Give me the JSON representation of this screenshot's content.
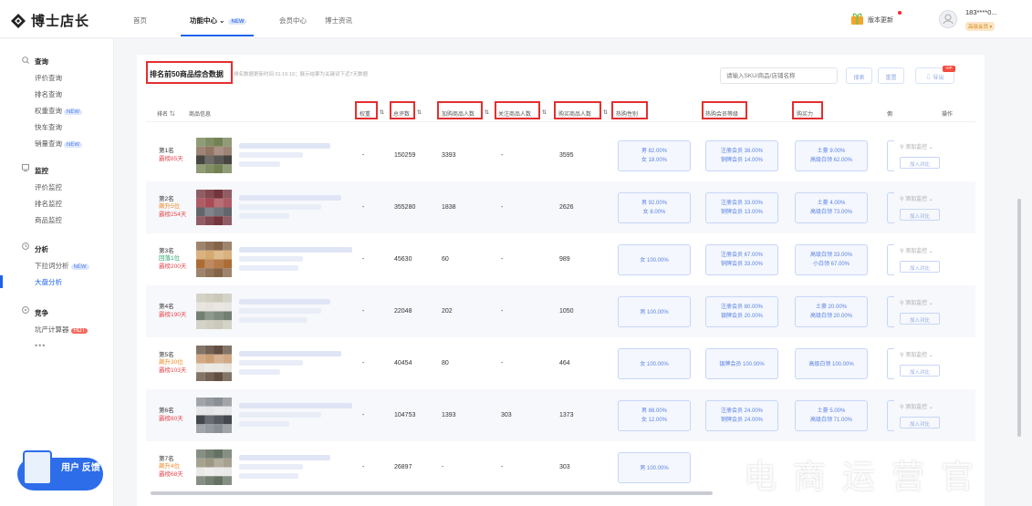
{
  "brand": {
    "name": "博士店长"
  },
  "nav": {
    "home": "首页",
    "features": "功能中心",
    "features_tag": "NEW",
    "member": "会员中心",
    "news": "博士资讯"
  },
  "header_right": {
    "version_update": "版本更新",
    "user": "183****0...",
    "vip": "高级会员"
  },
  "sidebar": {
    "sections": [
      {
        "title": "查询",
        "items": [
          {
            "label": "评价查询"
          },
          {
            "label": "排名查询"
          },
          {
            "label": "权重查询",
            "tag": "NEW"
          },
          {
            "label": "快车查询"
          },
          {
            "label": "销量查询",
            "tag": "NEW"
          }
        ]
      },
      {
        "title": "监控",
        "items": [
          {
            "label": "评价监控"
          },
          {
            "label": "排名监控"
          },
          {
            "label": "商品监控"
          }
        ]
      },
      {
        "title": "分析",
        "items": [
          {
            "label": "下拉词分析",
            "tag": "NEW"
          },
          {
            "label": "大盘分析"
          }
        ]
      },
      {
        "title": "竞争",
        "items": [
          {
            "label": "坑产计算器",
            "tag": "HOT"
          }
        ]
      }
    ],
    "more": "•••",
    "feedback": "用户 反馈"
  },
  "toolbar": {
    "title": "排名前50商品综合数据",
    "update_note": "排名数据更新时间 01:16:19；展示结果为关键词下近7天数据",
    "search_placeholder": "请输入SKU/商品/店铺名称",
    "search_btn": "搜索",
    "reset_btn": "重置",
    "export_btn": "导出",
    "export_tag": "VIP"
  },
  "table": {
    "headers": [
      "排名",
      "商品信息",
      "权重",
      "总评数",
      "加购商品人数",
      "关注商品人数",
      "购买商品人数",
      "热购性别",
      "热购会员等级",
      "购买力",
      "佣",
      "操作"
    ],
    "rows": [
      {
        "rank": "第1名",
        "sub": [
          {
            "t": "霸榜85天",
            "c": "red"
          }
        ],
        "weight": "-",
        "reviews": "150259",
        "cart": "3393",
        "follow": "-",
        "buy": "3595",
        "gender": [
          "男 82.00%",
          "女 18.00%"
        ],
        "member": [
          "注册会员 38.00%",
          "铜牌会员 14.00%"
        ],
        "power": [
          "土豪 9.00%",
          "高级白领 62.00%"
        ]
      },
      {
        "rank": "第2名",
        "sub": [
          {
            "t": "飙升5位",
            "c": "orange"
          },
          {
            "t": "霸榜254天",
            "c": "red"
          }
        ],
        "weight": "-",
        "reviews": "355280",
        "cart": "1838",
        "follow": "-",
        "buy": "2626",
        "gender": [
          "男 92.00%",
          "女 8.00%"
        ],
        "member": [
          "注册会员 33.00%",
          "铜牌会员 13.00%"
        ],
        "power": [
          "土豪 4.00%",
          "高级白领 73.00%"
        ]
      },
      {
        "rank": "第3名",
        "sub": [
          {
            "t": "回落1位",
            "c": "green"
          },
          {
            "t": "霸榜200天",
            "c": "red"
          }
        ],
        "weight": "-",
        "reviews": "45630",
        "cart": "60",
        "follow": "-",
        "buy": "989",
        "gender": [
          "女 100.00%"
        ],
        "member": [
          "注册会员 67.00%",
          "铜牌会员 33.00%"
        ],
        "power": [
          "高级白领 33.00%",
          "小白领 67.00%"
        ]
      },
      {
        "rank": "第4名",
        "sub": [
          {
            "t": "霸榜190天",
            "c": "red"
          }
        ],
        "weight": "-",
        "reviews": "22048",
        "cart": "202",
        "follow": "-",
        "buy": "1050",
        "gender": [
          "男 100.00%"
        ],
        "member": [
          "注册会员 80.00%",
          "银牌会员 20.00%"
        ],
        "power": [
          "土豪 20.00%",
          "高级白领 20.00%"
        ]
      },
      {
        "rank": "第5名",
        "sub": [
          {
            "t": "飙升30位",
            "c": "orange"
          },
          {
            "t": "霸榜103天",
            "c": "red"
          }
        ],
        "weight": "-",
        "reviews": "40454",
        "cart": "80",
        "follow": "-",
        "buy": "464",
        "gender": [
          "女 100.00%"
        ],
        "member": [
          "银牌会员 100.00%"
        ],
        "power": [
          "高级白领 100.00%"
        ]
      },
      {
        "rank": "第6名",
        "sub": [
          {
            "t": "霸榜80天",
            "c": "red"
          }
        ],
        "weight": "-",
        "reviews": "104753",
        "cart": "1393",
        "follow": "303",
        "buy": "1373",
        "gender": [
          "男 88.00%",
          "女 12.00%"
        ],
        "member": [
          "注册会员 24.00%",
          "铜牌会员 24.00%"
        ],
        "power": [
          "土豪 5.00%",
          "高级白领 71.00%"
        ]
      },
      {
        "rank": "第7名",
        "sub": [
          {
            "t": "飙升4位",
            "c": "orange"
          },
          {
            "t": "霸榜68天",
            "c": "red"
          }
        ],
        "weight": "-",
        "reviews": "26897",
        "cart": "-",
        "follow": "-",
        "buy": "303",
        "gender": [
          "男 100.00%"
        ],
        "member": [],
        "power": []
      }
    ],
    "op_monitor": "添加监控",
    "op_compare": "加入对比"
  },
  "watermark": "电商运营官"
}
